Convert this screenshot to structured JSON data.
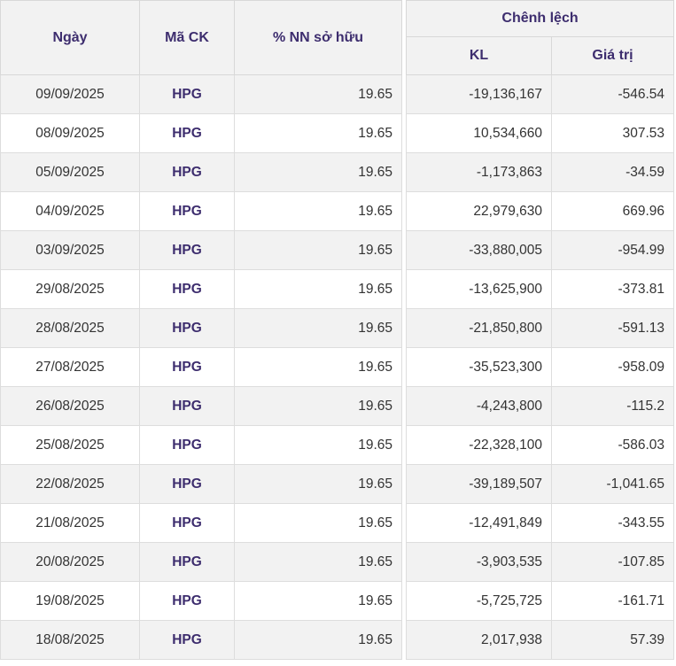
{
  "table": {
    "headers": {
      "date": "Ngày",
      "code": "Mã CK",
      "ownership": "% NN sở hữu",
      "diff_group": "Chênh lệch",
      "volume": "KL",
      "value": "Giá trị"
    },
    "rows": [
      {
        "date": "09/09/2025",
        "code": "HPG",
        "ownership": "19.65",
        "volume": "-19,136,167",
        "value": "-546.54"
      },
      {
        "date": "08/09/2025",
        "code": "HPG",
        "ownership": "19.65",
        "volume": "10,534,660",
        "value": "307.53"
      },
      {
        "date": "05/09/2025",
        "code": "HPG",
        "ownership": "19.65",
        "volume": "-1,173,863",
        "value": "-34.59"
      },
      {
        "date": "04/09/2025",
        "code": "HPG",
        "ownership": "19.65",
        "volume": "22,979,630",
        "value": "669.96"
      },
      {
        "date": "03/09/2025",
        "code": "HPG",
        "ownership": "19.65",
        "volume": "-33,880,005",
        "value": "-954.99"
      },
      {
        "date": "29/08/2025",
        "code": "HPG",
        "ownership": "19.65",
        "volume": "-13,625,900",
        "value": "-373.81"
      },
      {
        "date": "28/08/2025",
        "code": "HPG",
        "ownership": "19.65",
        "volume": "-21,850,800",
        "value": "-591.13"
      },
      {
        "date": "27/08/2025",
        "code": "HPG",
        "ownership": "19.65",
        "volume": "-35,523,300",
        "value": "-958.09"
      },
      {
        "date": "26/08/2025",
        "code": "HPG",
        "ownership": "19.65",
        "volume": "-4,243,800",
        "value": "-115.2"
      },
      {
        "date": "25/08/2025",
        "code": "HPG",
        "ownership": "19.65",
        "volume": "-22,328,100",
        "value": "-586.03"
      },
      {
        "date": "22/08/2025",
        "code": "HPG",
        "ownership": "19.65",
        "volume": "-39,189,507",
        "value": "-1,041.65"
      },
      {
        "date": "21/08/2025",
        "code": "HPG",
        "ownership": "19.65",
        "volume": "-12,491,849",
        "value": "-343.55"
      },
      {
        "date": "20/08/2025",
        "code": "HPG",
        "ownership": "19.65",
        "volume": "-3,903,535",
        "value": "-107.85"
      },
      {
        "date": "19/08/2025",
        "code": "HPG",
        "ownership": "19.65",
        "volume": "-5,725,725",
        "value": "-161.71"
      },
      {
        "date": "18/08/2025",
        "code": "HPG",
        "ownership": "19.65",
        "volume": "2,017,938",
        "value": "57.39"
      }
    ]
  },
  "colors": {
    "header_text": "#3d2d6e",
    "header_bg": "#f2f2f2",
    "stripe_bg": "#f2f2f2",
    "row_bg": "#ffffff",
    "text": "#333333"
  }
}
